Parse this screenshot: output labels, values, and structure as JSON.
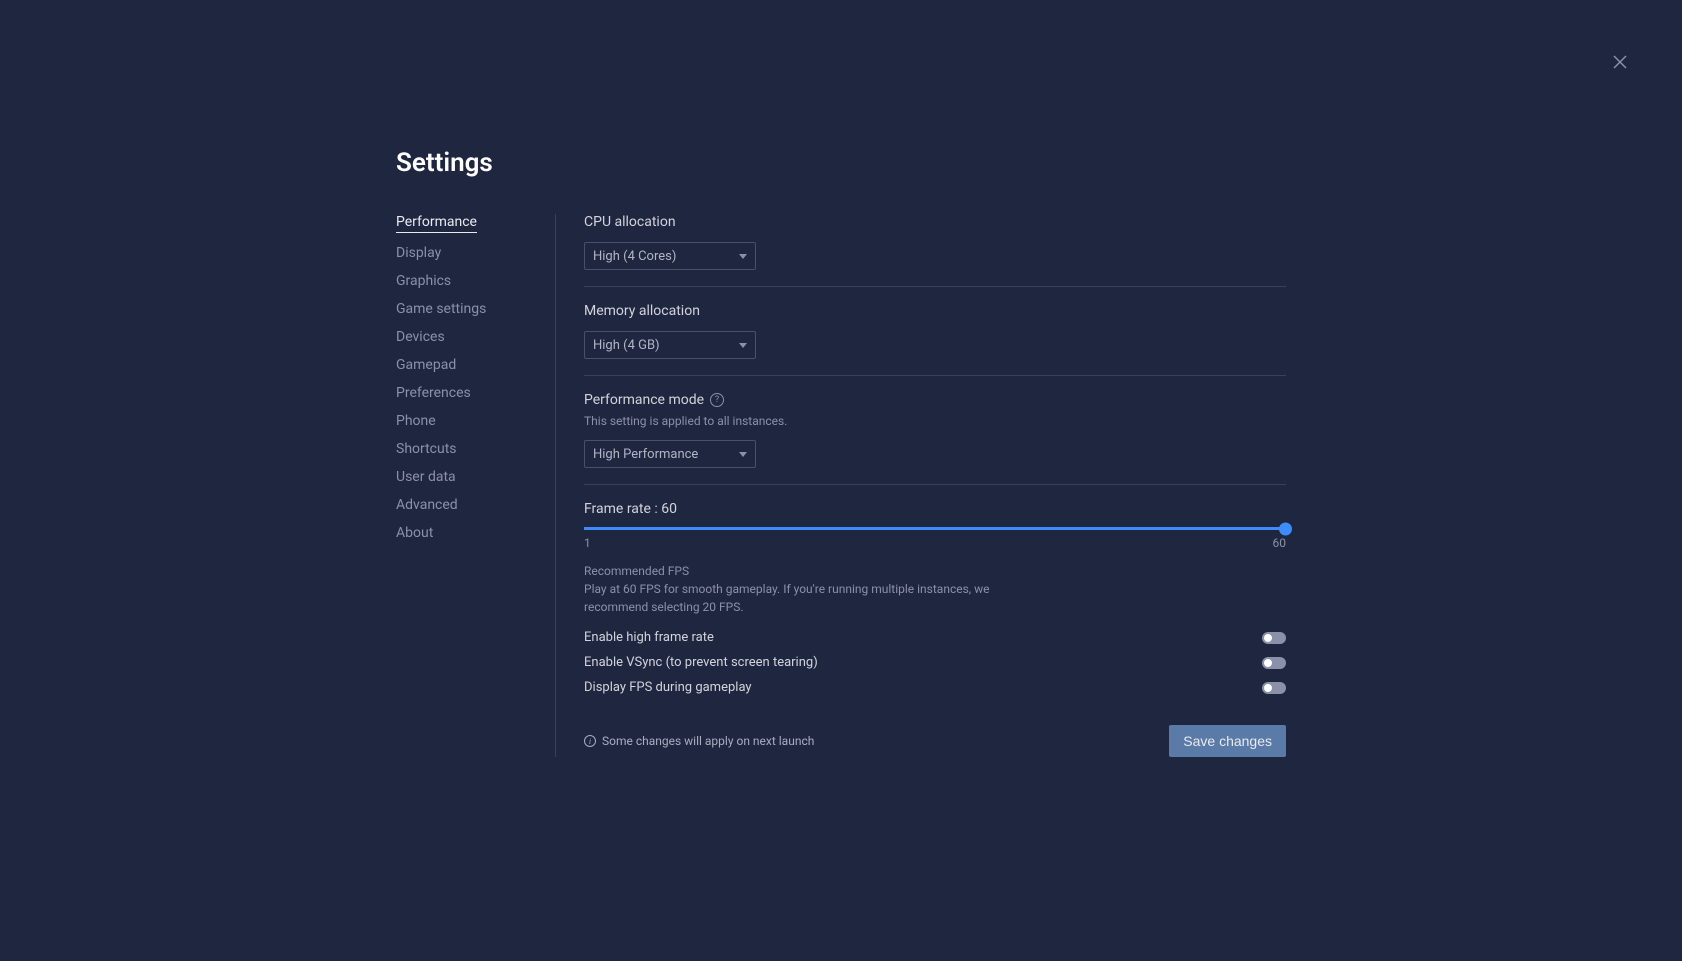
{
  "title": "Settings",
  "sidebar": {
    "items": [
      {
        "label": "Performance",
        "active": true
      },
      {
        "label": "Display",
        "active": false
      },
      {
        "label": "Graphics",
        "active": false
      },
      {
        "label": "Game settings",
        "active": false
      },
      {
        "label": "Devices",
        "active": false
      },
      {
        "label": "Gamepad",
        "active": false
      },
      {
        "label": "Preferences",
        "active": false
      },
      {
        "label": "Phone",
        "active": false
      },
      {
        "label": "Shortcuts",
        "active": false
      },
      {
        "label": "User data",
        "active": false
      },
      {
        "label": "Advanced",
        "active": false
      },
      {
        "label": "About",
        "active": false
      }
    ]
  },
  "cpu": {
    "label": "CPU allocation",
    "value": "High (4 Cores)"
  },
  "memory": {
    "label": "Memory allocation",
    "value": "High (4 GB)"
  },
  "performance_mode": {
    "label": "Performance mode",
    "subtext": "This setting is applied to all instances.",
    "value": "High Performance"
  },
  "frame_rate": {
    "label_prefix": "Frame rate : ",
    "value": "60",
    "min": "1",
    "max": "60",
    "recommended_title": "Recommended FPS",
    "recommended_text": "Play at 60 FPS for smooth gameplay. If you're running multiple instances, we recommend selecting 20 FPS."
  },
  "toggles": {
    "high_frame_rate": "Enable high frame rate",
    "vsync": "Enable VSync (to prevent screen tearing)",
    "display_fps": "Display FPS during gameplay"
  },
  "footer": {
    "note": "Some changes will apply on next launch",
    "save": "Save changes"
  }
}
